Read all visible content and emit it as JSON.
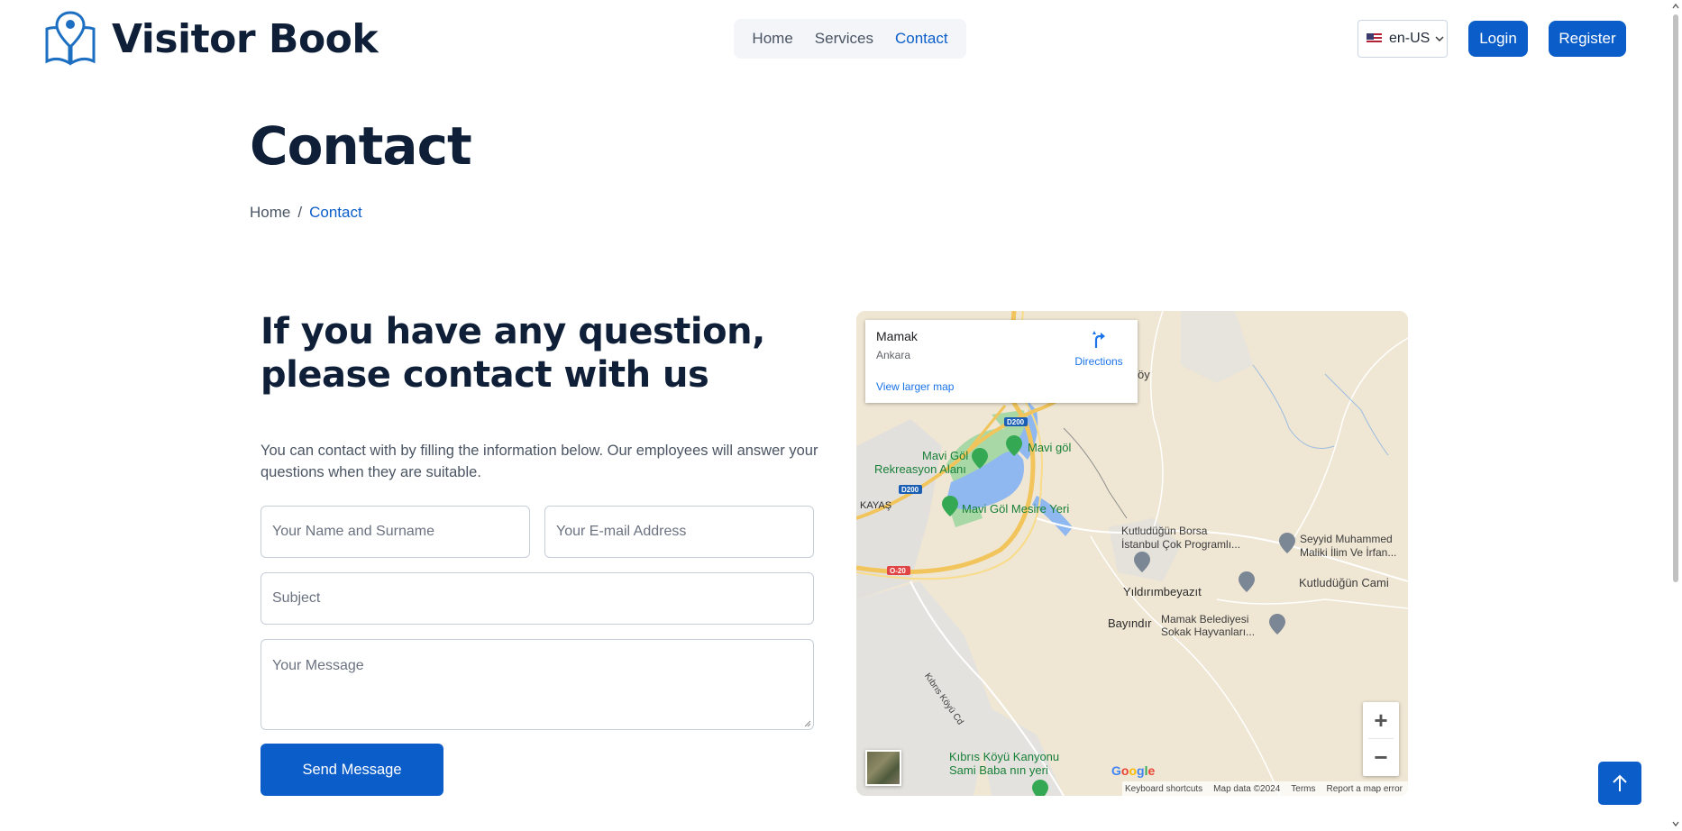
{
  "header": {
    "brand": "Visitor Book",
    "nav": [
      {
        "label": "Home",
        "active": false
      },
      {
        "label": "Services",
        "active": false
      },
      {
        "label": "Contact",
        "active": true
      }
    ],
    "language": "en-US",
    "login_label": "Login",
    "register_label": "Register"
  },
  "page": {
    "title": "Contact",
    "breadcrumb": {
      "home": "Home",
      "separator": "/",
      "current": "Contact"
    }
  },
  "contact": {
    "heading_line1": "If you have any question,",
    "heading_line2": "please contact with us",
    "description": "You can contact with by filling the information below. Our employees will answer your questions when they are suitable.",
    "form": {
      "name_placeholder": "Your Name and Surname",
      "email_placeholder": "Your E-mail Address",
      "subject_placeholder": "Subject",
      "message_placeholder": "Your Message",
      "submit_label": "Send Message"
    }
  },
  "map": {
    "place_title": "Mamak",
    "place_subtitle": "Ankara",
    "directions_label": "Directions",
    "larger_map_label": "View larger map",
    "labels": {
      "mavi_gol_rekreasyon_1": "Mavi Göl",
      "mavi_gol_rekreasyon_2": "Rekreasyon Alanı",
      "mavi_gol": "Mavi göl",
      "mavi_gol_mesire": "Mavi Göl Mesire Yeri",
      "kayas": "KAYAŞ",
      "d200_a": "D200",
      "d200_b": "D200",
      "o20": "O-20",
      "borsa_1": "Kutludüğün Borsa",
      "borsa_2": "İstanbul Çok Programlı...",
      "seyyid_1": "Seyyid Muhammed",
      "seyyid_2": "Maliki İlim Ve İrfan...",
      "yildirimbeyazit": "Yıldırımbeyazıt",
      "kutludugun_cami": "Kutludüğün Cami",
      "bayindir": "Bayındır",
      "mamak_belediyesi_1": "Mamak Belediyesi",
      "mamak_belediyesi_2": "Sokak Hayvanları...",
      "kibris_koyu_cd": "Kıbrıs Köyü Cd",
      "kanyon_1": "Kıbrıs Köyü Kanyonu",
      "kanyon_2": "Sami Baba nın yeri",
      "partial_koy": "öy"
    },
    "google": "Google",
    "attribution": [
      "Keyboard shortcuts",
      "Map data ©2024",
      "Terms",
      "Report a map error"
    ],
    "zoom_in": "+",
    "zoom_out": "−"
  },
  "colors": {
    "primary": "#0b5ec9",
    "heading": "#0f1f38",
    "text_muted": "#4b5563"
  },
  "icons": {
    "logo": "book-location-pin-icon",
    "to_top": "arrow-up-icon",
    "directions": "directions-arrow-icon"
  }
}
